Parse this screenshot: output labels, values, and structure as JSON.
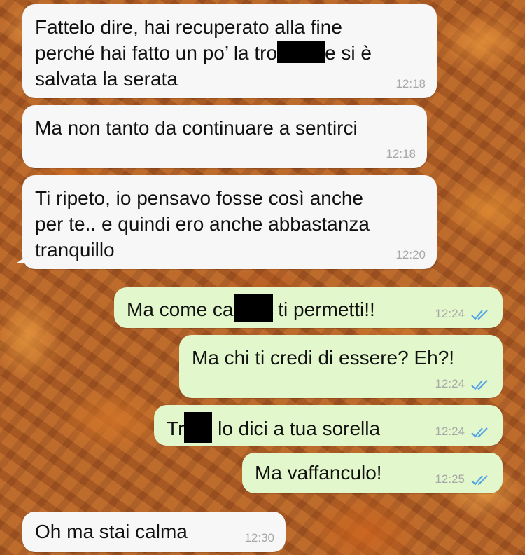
{
  "messages": [
    {
      "id": "m1",
      "dir": "in",
      "pre": "Fattelo dire, hai recuperato alla fine\nperché hai fatto un po’ la tro",
      "post": "e si è\nsalvata la serata",
      "time": "12:18"
    },
    {
      "id": "m2",
      "dir": "in",
      "text": "Ma non tanto da continuare a sentirci",
      "time": "12:18"
    },
    {
      "id": "m3",
      "dir": "in",
      "text": "Ti ripeto, io pensavo fosse così anche\nper te.. e quindi ero anche abbastanza\ntranquillo",
      "time": "12:20"
    },
    {
      "id": "m4",
      "dir": "out",
      "pre": "Ma come ca",
      "post": "ti permetti!!",
      "time": "12:24",
      "status": "read"
    },
    {
      "id": "m5",
      "dir": "out",
      "text": "Ma chi ti credi di essere? Eh?!",
      "time": "12:24",
      "status": "read"
    },
    {
      "id": "m6",
      "dir": "out",
      "pre": "Tr",
      "post": "lo dici a tua sorella",
      "time": "12:24",
      "status": "read"
    },
    {
      "id": "m7",
      "dir": "out",
      "text": "Ma vaffanculo!",
      "time": "12:25",
      "status": "read"
    },
    {
      "id": "m8",
      "dir": "in",
      "text": "Oh ma stai calma",
      "time": "12:30"
    }
  ],
  "colors": {
    "incoming": "#f7f7f7",
    "outgoing": "#e2f7cb",
    "read_ticks": "#4fa3e6",
    "timestamp": "#a8a8a8"
  },
  "icons": {
    "read_receipt": "double-check-icon",
    "redaction": "redaction-bar"
  }
}
